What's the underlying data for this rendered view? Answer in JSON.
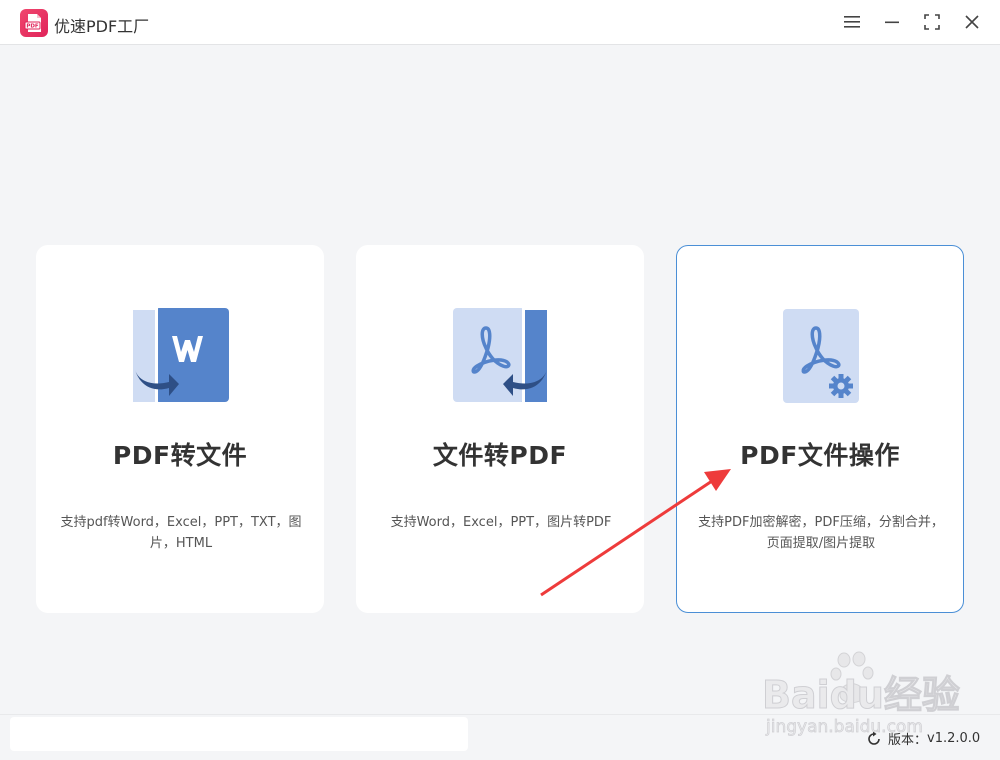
{
  "app": {
    "title": "优速PDF工厂",
    "logo_text": "PDF",
    "accent": "#4b8fd6",
    "logo_color": "#e8336a"
  },
  "window_controls": [
    {
      "name": "menu-icon"
    },
    {
      "name": "minimize-icon"
    },
    {
      "name": "maximize-icon"
    },
    {
      "name": "close-icon"
    }
  ],
  "cards": [
    {
      "title": "PDF转文件",
      "description": "支持pdf转Word，Excel，PPT，TXT，图片，HTML",
      "icon": "pdf-to-word-icon",
      "icon_letter": "W"
    },
    {
      "title": "文件转PDF",
      "description": "支持Word，Excel，PPT，图片转PDF",
      "icon": "file-to-pdf-icon"
    },
    {
      "title": "PDF文件操作",
      "description": "支持PDF加密解密，PDF压缩，分割合并，页面提取/图片提取",
      "icon": "pdf-operations-icon",
      "active": true
    }
  ],
  "footer": {
    "version_label": "版本：",
    "version_value": "v1.2.0.0"
  },
  "watermark": {
    "brand": "Baidu经验",
    "url": "jingyan.baidu.com"
  }
}
